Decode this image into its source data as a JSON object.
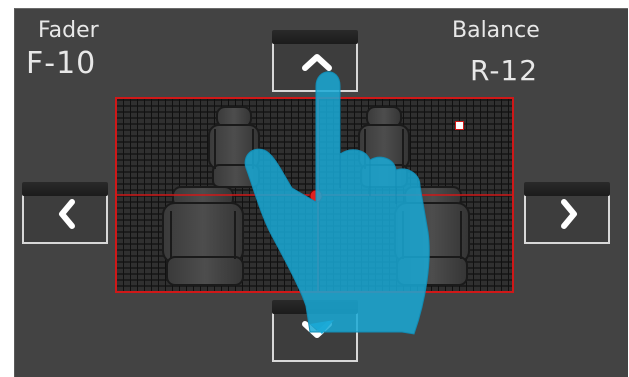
{
  "fader": {
    "title": "Fader",
    "value": "F-10"
  },
  "balance": {
    "title": "Balance",
    "value": "R-12"
  },
  "buttons": {
    "up": {
      "icon": "chevron-up-icon"
    },
    "down": {
      "icon": "chevron-down-icon"
    },
    "left": {
      "icon": "chevron-left-icon"
    },
    "right": {
      "icon": "chevron-right-icon"
    }
  },
  "colors": {
    "panel": "#434343",
    "field_border": "#d01818",
    "crosshair": "#d01818",
    "hand": "#19a9d6"
  }
}
